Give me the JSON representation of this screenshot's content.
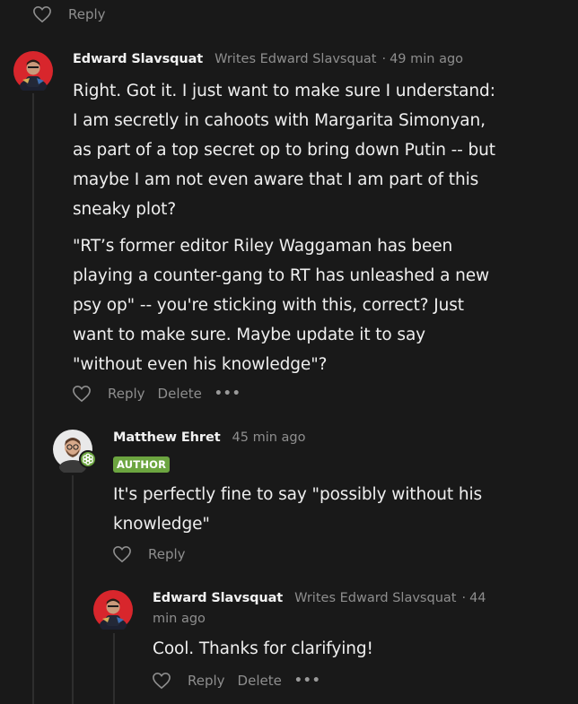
{
  "top_actions": {
    "reply_label": "Reply"
  },
  "comments": [
    {
      "author": "Edward Slavsquat",
      "byline": "Writes Edward Slavsquat",
      "separator": "·",
      "time": "49 min ago",
      "paragraphs": [
        "Right. Got it. I just want to make sure I understand: I am secretly in cahoots with Margarita Simonyan, as part of a top secret op to bring down Putin -- but maybe I am not even aware that I am part of this sneaky plot?",
        "\"RT’s former editor Riley Waggaman has been playing a counter-gang to RT has unleashed a new psy op\" -- you're sticking with this, correct? Just want to make sure. Maybe update it to say \"without even his knowledge\"?"
      ],
      "actions": {
        "reply_label": "Reply",
        "delete_label": "Delete",
        "more_label": "•••"
      }
    },
    {
      "author": "Matthew Ehret",
      "time": "45 min ago",
      "badge": "AUTHOR",
      "badge_color": "#6ca540",
      "paragraphs": [
        "It's perfectly fine to say \"possibly without his knowledge\""
      ],
      "actions": {
        "reply_label": "Reply"
      }
    },
    {
      "author": "Edward Slavsquat",
      "byline": "Writes Edward Slavsquat",
      "separator": "·",
      "time_part1": "44",
      "time_part2": "min ago",
      "paragraphs": [
        "Cool. Thanks for clarifying!"
      ],
      "actions": {
        "reply_label": "Reply",
        "delete_label": "Delete",
        "more_label": "•••"
      }
    }
  ],
  "icons": {
    "heart": "heart-icon",
    "more": "more-options-icon",
    "badge_icon": "flower-badge-icon"
  },
  "colors": {
    "background": "#191919",
    "muted": "#8e8e8e",
    "author_badge": "#6ca540"
  }
}
